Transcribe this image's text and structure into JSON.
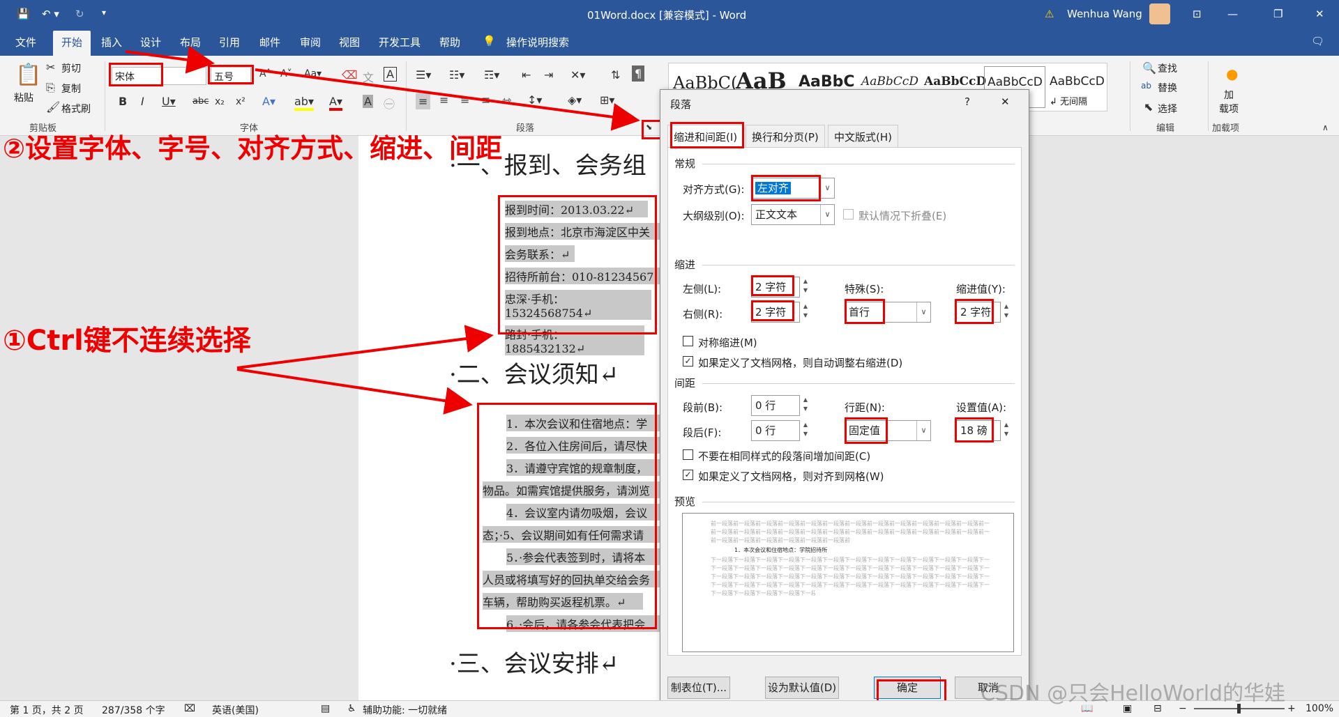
{
  "titlebar": {
    "doc_title": "01Word.docx [兼容模式] - Word",
    "user": "Wenhua Wang"
  },
  "tabs": [
    "文件",
    "开始",
    "插入",
    "设计",
    "布局",
    "引用",
    "邮件",
    "审阅",
    "视图",
    "开发工具",
    "帮助",
    "操作说明搜索"
  ],
  "ribbon": {
    "clipboard": {
      "paste": "粘贴",
      "cut": "剪切",
      "copy": "复制",
      "format_painter": "格式刷",
      "group": "剪贴板"
    },
    "font": {
      "name": "宋体",
      "size": "五号",
      "group": "字体",
      "aa": "Aa",
      "a_letter": "A"
    },
    "paragraph": {
      "group": "段落"
    },
    "styles": [
      "AaBbC(",
      "AaB",
      "AaBbC",
      "AaBbCcD",
      "AaBbCcD",
      "AaBbCcD",
      "AaBbCcD"
    ],
    "no_spacing": "↲ 无间隔",
    "editing": {
      "find": "查找",
      "replace": "替换",
      "select": "选择",
      "group": "编辑"
    },
    "addins": {
      "label": "加\n载项",
      "group": "加载项"
    }
  },
  "annotations": {
    "step2": "②设置字体、字号、对齐方式、缩进、间距",
    "step1": "①Ctrl键不连续选择"
  },
  "document": {
    "h1": "·一、报到、会务组",
    "block1": [
      "报到时间：2013.03.22↵",
      "报到地点：北京市海淀区中关",
      "会务联系：↵",
      "招待所前台：010-81234567",
      "忠深·手机：15324568754↵",
      "路封·手机：1885432132↵"
    ],
    "h2": "·二、会议须知↵",
    "block2": [
      "1．本次会议和住宿地点：学",
      "2．各位入住房间后，请尽快",
      "3．请遵守宾馆的规章制度，",
      "物品。如需宾馆提供服务，请浏览",
      "4．会议室内请勿吸烟，会议",
      "态；·5、会议期间如有任何需求请",
      "5．·参会代表签到时，请将本",
      "人员或将填写好的回执单交给会务",
      "车辆，帮助购买返程机票。↵",
      "6．·会后，请各参会代表把会"
    ],
    "h3": "·三、会议安排↵"
  },
  "dialog": {
    "title": "段落",
    "help": "?",
    "close": "✕",
    "tabs": [
      "缩进和间距(I)",
      "换行和分页(P)",
      "中文版式(H)"
    ],
    "general": "常规",
    "alignment_label": "对齐方式(G):",
    "alignment_value": "左对齐",
    "outline_label": "大纲级别(O):",
    "outline_value": "正文文本",
    "collapse_label": "默认情况下折叠(E)",
    "indent": "缩进",
    "left_label": "左侧(L):",
    "left_value": "2 字符",
    "right_label": "右侧(R):",
    "right_value": "2 字符",
    "special_label": "特殊(S):",
    "special_value": "首行",
    "indent_by_label": "缩进值(Y):",
    "indent_by_value": "2 字符",
    "mirror_label": "对称缩进(M)",
    "auto_adjust_label": "如果定义了文档网格，则自动调整右缩进(D)",
    "spacing": "间距",
    "before_label": "段前(B):",
    "before_value": "0 行",
    "after_label": "段后(F):",
    "after_value": "0 行",
    "line_spacing_label": "行距(N):",
    "line_spacing_value": "固定值",
    "at_label": "设置值(A):",
    "at_value": "18 磅",
    "no_space_label": "不要在相同样式的段落间增加间距(C)",
    "snap_grid_label": "如果定义了文档网格，则对齐到网格(W)",
    "preview": "预览",
    "preview_prev": "前一段落前一段落前一段落前一段落前一段落前一段落前一段落前一段落前一段落前一段落前一段落前一段落前一段落前一段落前一段落前一段落前一段落前一段落前一段落前一段落",
    "preview_cur": "1．本次会议和住宿地点：学院招待所",
    "preview_next": "下一段落下一段落下一段落下一段落下一段落下一段落下一段落下一段落下一段落下一段落下一段落下一段落下一段落下一段落下一段落下一段落下一段落下一段落下一段落下一段落",
    "tabs_button": "制表位(T)...",
    "default_button": "设为默认值(D)",
    "ok": "确定",
    "cancel": "取消"
  },
  "status": {
    "page": "第 1 页，共 2 页",
    "words": "287/358 个字",
    "lang": "英语(美国)",
    "access": "辅助功能: 一切就绪",
    "zoom": "100%"
  },
  "watermark": "CSDN @只会HelloWorld的华娃"
}
